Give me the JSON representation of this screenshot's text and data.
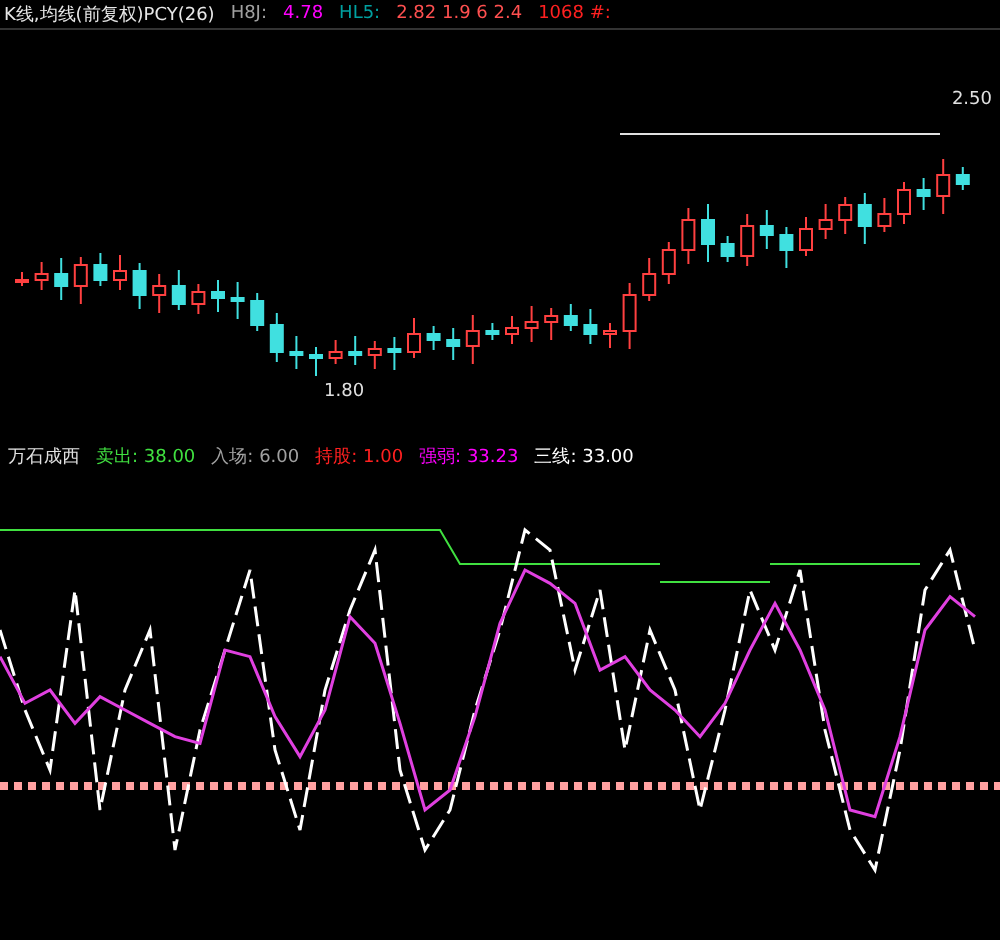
{
  "header": [
    {
      "text": "K线,均线(前复权)PCY(26)",
      "color": "#e8e8e8"
    },
    {
      "text": "H8J:",
      "color": "#a0a0a0"
    },
    {
      "text": "4.78",
      "color": "#ff00ff"
    },
    {
      "text": "HL5:",
      "color": "#00a0a0"
    },
    {
      "text": "2.82 1.9 6 2.4",
      "color": "#ff5050"
    },
    {
      "text": "1068 #:",
      "color": "#ff2020"
    }
  ],
  "main_chart": {
    "high_label": "2.50",
    "low_label": "1.80"
  },
  "indicator": {
    "title": "万石成西",
    "values": [
      {
        "text": "卖出: 38.00",
        "color": "#40e040"
      },
      {
        "text": "入场: 6.00",
        "color": "#a0a0a0"
      },
      {
        "text": "持股: 1.00",
        "color": "#ff2020"
      },
      {
        "text": "强弱: 33.23",
        "color": "#ff00ff"
      },
      {
        "text": "三线: 33.00",
        "color": "#ffffff"
      }
    ]
  }
}
